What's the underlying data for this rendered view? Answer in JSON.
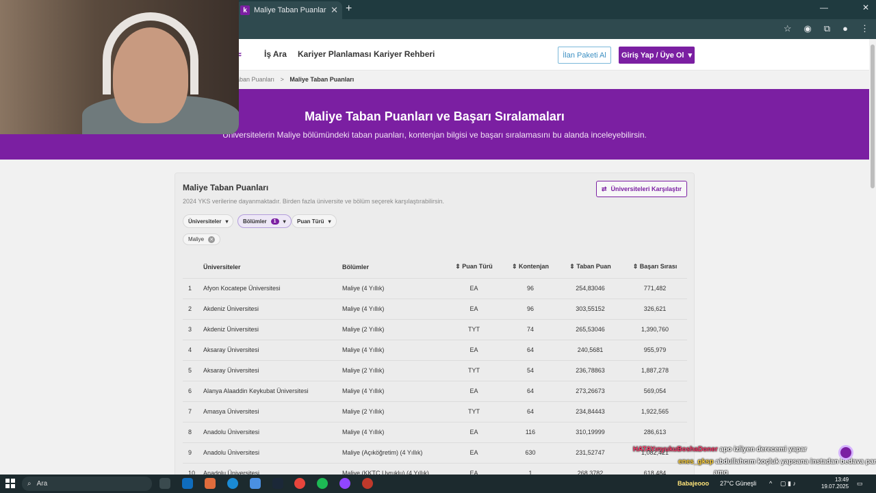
{
  "browser": {
    "tab_title": "Maliye Taban Puanları ve Başar",
    "tab_favicon": "k",
    "new_tab": "+",
    "minimize": "—",
    "maximize": "☐",
    "close": "✕"
  },
  "nav": {
    "items": [
      "İş Ara",
      "Kariyer Planlaması",
      "Kariyer Rehberi"
    ],
    "ilan_button": "İlan Paketi Al",
    "login_button": "Giriş Yap / Üye Ol"
  },
  "breadcrumb": {
    "parent": "aban Puanları",
    "sep": ">",
    "current": "Maliye Taban Puanları"
  },
  "hero": {
    "title": "Maliye Taban Puanları ve Başarı Sıralamaları",
    "subtitle": "Üniversitelerin Maliye bölümündeki taban puanları, kontenjan bilgisi ve başarı sıralamasını bu alanda inceleyebilirsin."
  },
  "card": {
    "title": "Maliye Taban Puanları",
    "subtitle": "2024 YKS verilerine dayanmaktadır. Birden fazla üniversite ve bölüm seçerek karşılaştırabilirsin.",
    "compare_button": "Üniversiteleri Karşılaştır",
    "filters": {
      "universities": "Üniversiteler",
      "departments": "Bölümler",
      "departments_count": "1",
      "score_type": "Puan Türü"
    },
    "chip": "Maliye"
  },
  "table": {
    "headers": [
      "",
      "Üniversiteler",
      "Bölümler",
      "Puan Türü",
      "Kontenjan",
      "Taban Puan",
      "Başarı Sırası"
    ],
    "rows": [
      [
        "1",
        "Afyon Kocatepe Üniversitesi",
        "Maliye (4 Yıllık)",
        "EA",
        "96",
        "254,83046",
        "771,482"
      ],
      [
        "2",
        "Akdeniz Üniversitesi",
        "Maliye (4 Yıllık)",
        "EA",
        "96",
        "303,55152",
        "326,621"
      ],
      [
        "3",
        "Akdeniz Üniversitesi",
        "Maliye (2 Yıllık)",
        "TYT",
        "74",
        "265,53046",
        "1,390,760"
      ],
      [
        "4",
        "Aksaray Üniversitesi",
        "Maliye (4 Yıllık)",
        "EA",
        "64",
        "240,5681",
        "955,979"
      ],
      [
        "5",
        "Aksaray Üniversitesi",
        "Maliye (2 Yıllık)",
        "TYT",
        "54",
        "236,78863",
        "1,887,278"
      ],
      [
        "6",
        "Alanya Alaaddin Keykubat Üniversitesi",
        "Maliye (4 Yıllık)",
        "EA",
        "64",
        "273,26673",
        "569,054"
      ],
      [
        "7",
        "Amasya Üniversitesi",
        "Maliye (2 Yıllık)",
        "TYT",
        "64",
        "234,84443",
        "1,922,565"
      ],
      [
        "8",
        "Anadolu Üniversitesi",
        "Maliye (4 Yıllık)",
        "EA",
        "116",
        "310,19999",
        "286,613"
      ],
      [
        "9",
        "Anadolu Üniversitesi",
        "Maliye (Açıköğretim) (4 Yıllık)",
        "EA",
        "630",
        "231,52747",
        "1,082,421"
      ],
      [
        "10",
        "Anadolu Üniversitesi",
        "Maliye (KKTC Uyruklu) (4 Yıllık)",
        "EA",
        "1",
        "268,3782",
        "618,484"
      ]
    ]
  },
  "chat": {
    "line1_user": "HATAYınyukuBoshaDoner",
    "line1_msg": "apo izliyen derecemi yapar",
    "line2_user": "enes_gksp",
    "line2_msg": "abdullahcım koçluk yapsana instadan bedava para",
    "line3_msg": "amg"
  },
  "taskbar": {
    "search": "Ara",
    "user": "Babajeooo",
    "weather": "27°C  Güneşli",
    "time": "13:49",
    "date": "19.07.2025"
  }
}
